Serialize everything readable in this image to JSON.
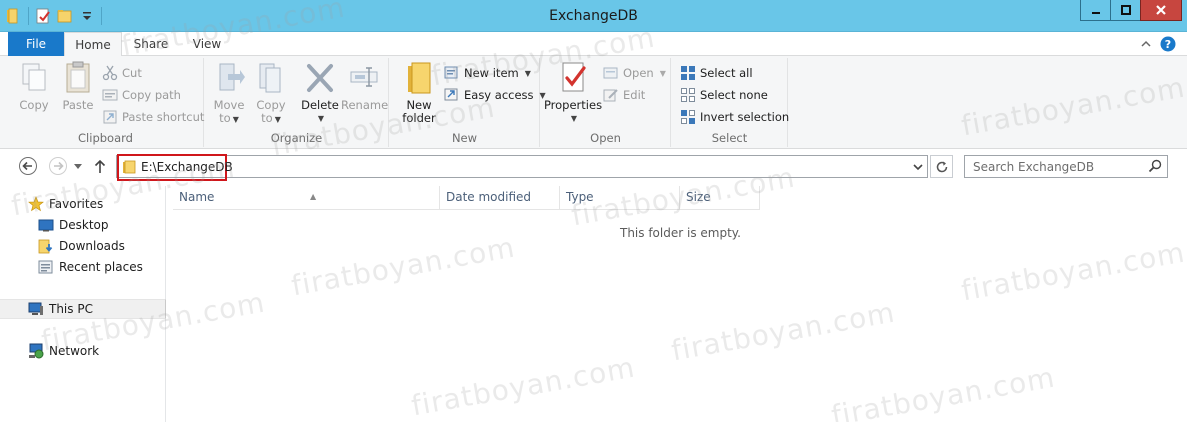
{
  "window": {
    "title": "ExchangeDB"
  },
  "ribbon_tabs": [
    "File",
    "Home",
    "Share",
    "View"
  ],
  "clipboard": {
    "copy": "Copy",
    "paste": "Paste",
    "cut": "Cut",
    "copy_path": "Copy path",
    "paste_shortcut": "Paste shortcut",
    "label": "Clipboard"
  },
  "organize": {
    "move_to_1": "Move",
    "move_to_2": "to",
    "copy_to_1": "Copy",
    "copy_to_2": "to",
    "delete": "Delete",
    "rename": "Rename",
    "label": "Organize"
  },
  "new": {
    "new_folder_1": "New",
    "new_folder_2": "folder",
    "new_item": "New item",
    "easy_access": "Easy access",
    "label": "New"
  },
  "open": {
    "properties": "Properties",
    "open": "Open",
    "edit": "Edit",
    "label": "Open"
  },
  "select": {
    "select_all": "Select all",
    "select_none": "Select none",
    "invert_selection": "Invert selection",
    "label": "Select"
  },
  "address": {
    "path": "E:\\ExchangeDB"
  },
  "search": {
    "placeholder": "Search ExchangeDB"
  },
  "nav_pane": {
    "favorites": "Favorites",
    "desktop": "Desktop",
    "downloads": "Downloads",
    "recent_places": "Recent places",
    "this_pc": "This PC",
    "network": "Network"
  },
  "columns": [
    "Name",
    "Date modified",
    "Type",
    "Size"
  ],
  "content": {
    "empty_message": "This folder is empty."
  },
  "watermark": "firatboyan.com",
  "colors": {
    "title_bar": "#69c6e8",
    "file_tab": "#1979ca",
    "close_button": "#c7463f",
    "highlight_border": "#d0161b"
  }
}
